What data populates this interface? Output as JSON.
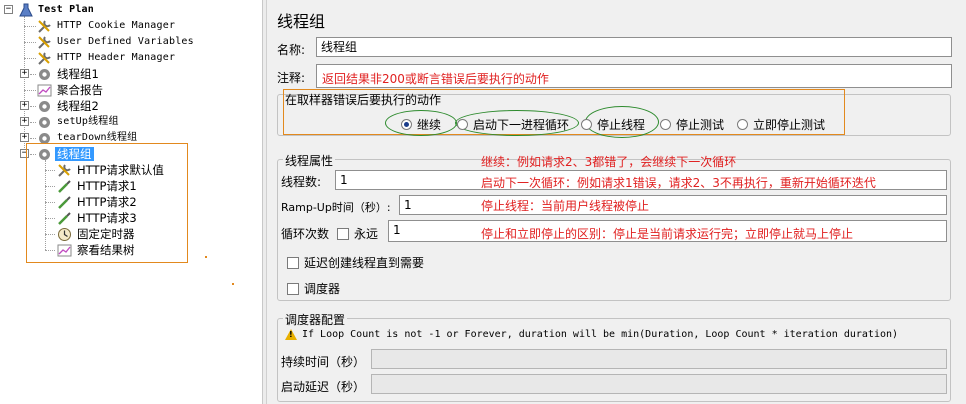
{
  "tree": {
    "root": {
      "label": "Test Plan"
    },
    "items": [
      {
        "label": "HTTP Cookie Manager",
        "icon": "wrench-icon"
      },
      {
        "label": "User Defined Variables",
        "icon": "wrench-icon"
      },
      {
        "label": "HTTP Header Manager",
        "icon": "wrench-icon"
      },
      {
        "label": "线程组1",
        "icon": "gear-icon"
      },
      {
        "label": "聚合报告",
        "icon": "chart-icon"
      },
      {
        "label": "线程组2",
        "icon": "gear-icon"
      },
      {
        "label": "setUp线程组",
        "icon": "gear-icon"
      },
      {
        "label": "tearDown线程组",
        "icon": "gear-icon"
      },
      {
        "label": "线程组",
        "icon": "gear-icon"
      },
      {
        "label": "HTTP请求默认值",
        "icon": "wrench-icon"
      },
      {
        "label": "HTTP请求1",
        "icon": "pipette-icon"
      },
      {
        "label": "HTTP请求2",
        "icon": "pipette-icon"
      },
      {
        "label": "HTTP请求3",
        "icon": "pipette-icon"
      },
      {
        "label": "固定定时器",
        "icon": "timer-icon"
      },
      {
        "label": "察看结果树",
        "icon": "chart-icon"
      }
    ]
  },
  "panel": {
    "title": "线程组",
    "name_label": "名称:",
    "name_value": "线程组",
    "comment_label": "注释:",
    "comment_value": "返回结果非200或断言错误后要执行的动作",
    "error_action": {
      "title": "在取样器错误后要执行的动作",
      "options": [
        "继续",
        "启动下一进程循环",
        "停止线程",
        "停止测试",
        "立即停止测试"
      ],
      "selected": "继续"
    },
    "thread_props": {
      "title": "线程属性",
      "threads_label": "线程数:",
      "threads_value": "1",
      "rampup_label": "Ramp-Up时间（秒）:",
      "rampup_value": "1",
      "loop_label": "循环次数",
      "forever_label": "永远",
      "loop_value": "1",
      "delay_label": "延迟创建线程直到需要",
      "scheduler_label": "调度器"
    },
    "scheduler": {
      "title": "调度器配置",
      "warning": "If Loop Count is not -1 or Forever, duration will be min(Duration, Loop Count * iteration duration)",
      "duration_label": "持续时间（秒）",
      "delay_label": "启动延迟（秒）"
    },
    "annotations": [
      "继续：例如请求2、3都错了，会继续下一次循环",
      "启动下一次循环：例如请求1错误，请求2、3不再执行，重新开始循环迭代",
      "停止线程：当前用户线程被停止",
      "停止和立即停止的区别：停止是当前请求运行完；立即停止就马上停止"
    ]
  },
  "colors": {
    "annotation": "#e02020",
    "highlight_box": "#e2891e",
    "ellipse": "#2e8b2e",
    "selection": "#3399ff"
  }
}
